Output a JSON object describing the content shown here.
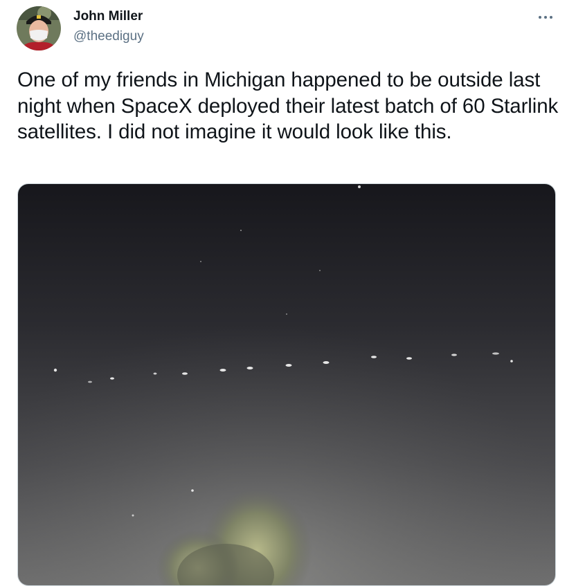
{
  "tweet": {
    "author_name": "John Miller",
    "author_handle": "@theediguy",
    "text": "One of my friends in Michigan happened to be outside last night when SpaceX deployed their latest batch of 60 Starlink satellites. I did not imagine it would look like this."
  },
  "icons": {
    "more": "more-horizontal-icon"
  }
}
